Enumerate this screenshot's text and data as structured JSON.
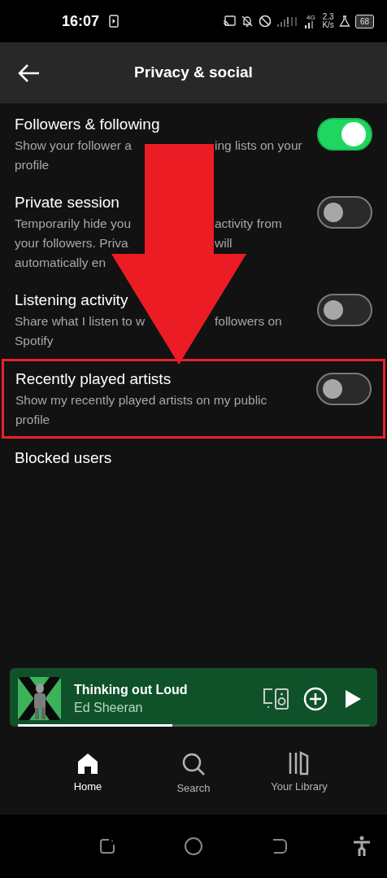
{
  "status_bar": {
    "time": "16:07",
    "network_type": "4G",
    "speed_value": "2.3",
    "speed_unit": "K/s",
    "battery": "68"
  },
  "header": {
    "title": "Privacy & social"
  },
  "settings": [
    {
      "kind": "toggle",
      "title": "Followers & following",
      "lines": [
        [
          "Show your follower a",
          "ing lists on your"
        ],
        [
          "profile"
        ]
      ],
      "on": true,
      "highlighted": false
    },
    {
      "kind": "toggle",
      "title": "Private session",
      "lines": [
        [
          "Temporarily hide you",
          "activity from"
        ],
        [
          "your followers. Priva",
          "will"
        ],
        [
          "automatically en"
        ]
      ],
      "on": false,
      "highlighted": false
    },
    {
      "kind": "toggle",
      "title": "Listening activity",
      "lines": [
        [
          "Share what I listen to w",
          "followers on"
        ],
        [
          "Spotify"
        ]
      ],
      "on": false,
      "highlighted": false
    },
    {
      "kind": "toggle",
      "title": "Recently played artists",
      "lines": [
        [
          "Show my recently played artists on my public"
        ],
        [
          "profile"
        ]
      ],
      "on": false,
      "highlighted": true
    },
    {
      "kind": "link",
      "title": "Blocked users",
      "highlighted": false
    }
  ],
  "player": {
    "title": "Thinking out Loud",
    "artist": "Ed Sheeran",
    "level": 0.44
  },
  "nav": [
    {
      "label": "Home",
      "selected": true
    },
    {
      "label": "Search",
      "selected": false
    },
    {
      "label": "Your Library",
      "selected": false
    }
  ]
}
